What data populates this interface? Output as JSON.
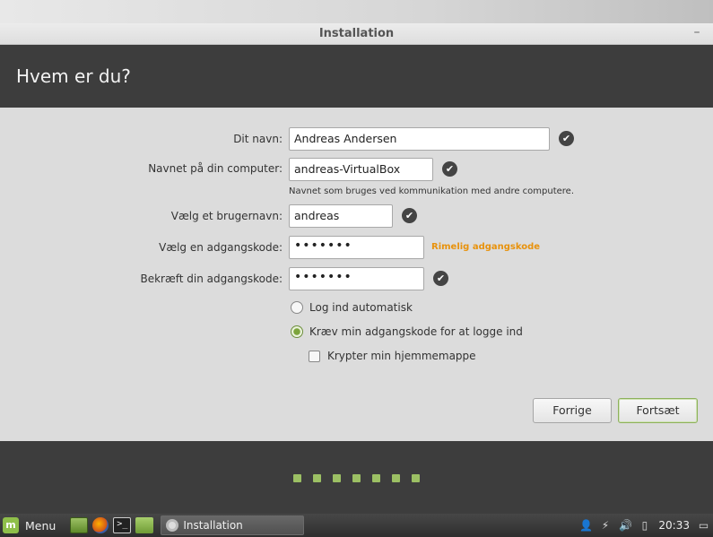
{
  "window": {
    "title": "Installation",
    "minimize_label": "–"
  },
  "header": {
    "heading": "Hvem er du?"
  },
  "form": {
    "name": {
      "label": "Dit navn:",
      "value": "Andreas Andersen"
    },
    "computer": {
      "label": "Navnet på din computer:",
      "value": "andreas-VirtualBox",
      "hint": "Navnet som bruges ved kommunikation med andre computere."
    },
    "username": {
      "label": "Vælg et brugernavn:",
      "value": "andreas"
    },
    "password": {
      "label": "Vælg en adgangskode:",
      "value": "•••••••",
      "strength": "Rimelig adgangskode"
    },
    "confirm": {
      "label": "Bekræft din adgangskode:",
      "value": "•••••••"
    },
    "check_glyph": "✔",
    "options": {
      "auto_login": {
        "label": "Log ind automatisk",
        "selected": false
      },
      "require_password": {
        "label": "Kræv min adgangskode for at logge ind",
        "selected": true
      },
      "encrypt_home": {
        "label": "Krypter min hjemmemappe",
        "checked": false
      }
    }
  },
  "buttons": {
    "back": "Forrige",
    "continue": "Fortsæt"
  },
  "progress": {
    "steps": 7
  },
  "taskbar": {
    "menu_label": "Menu",
    "terminal_glyph": ">_",
    "task_label": "Installation",
    "clock": "20:33",
    "accent": "#8fbf4a"
  }
}
